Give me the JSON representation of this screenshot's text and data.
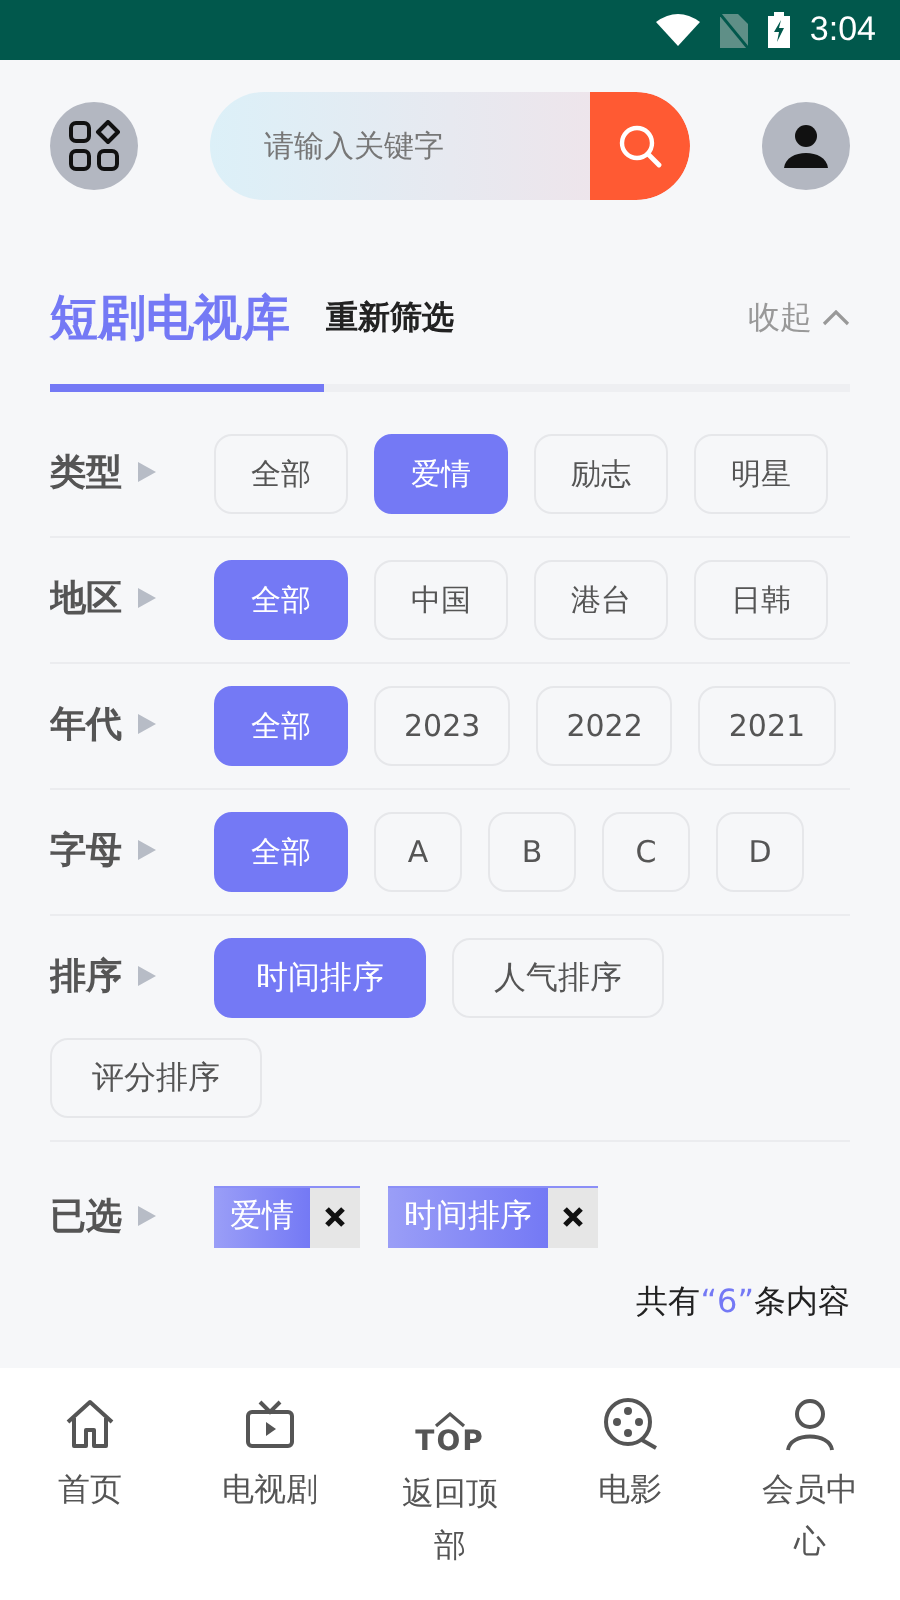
{
  "status_bar": {
    "time": "3:04"
  },
  "search": {
    "placeholder": "请输入关键字"
  },
  "header": {
    "title": "短剧电视库",
    "reset": "重新筛选",
    "collapse": "收起"
  },
  "filters": [
    {
      "label": "类型",
      "kind": "scroll",
      "options": [
        {
          "text": "全部",
          "selected": false
        },
        {
          "text": "爱情",
          "selected": true
        },
        {
          "text": "励志",
          "selected": false
        },
        {
          "text": "明星",
          "selected": false
        }
      ]
    },
    {
      "label": "地区",
      "kind": "scroll",
      "options": [
        {
          "text": "全部",
          "selected": true
        },
        {
          "text": "中国",
          "selected": false
        },
        {
          "text": "港台",
          "selected": false
        },
        {
          "text": "日韩",
          "selected": false
        }
      ]
    },
    {
      "label": "年代",
      "kind": "scroll",
      "options": [
        {
          "text": "全部",
          "selected": true
        },
        {
          "text": "2023",
          "selected": false
        },
        {
          "text": "2022",
          "selected": false
        },
        {
          "text": "2021",
          "selected": false
        }
      ]
    },
    {
      "label": "字母",
      "kind": "scroll",
      "options": [
        {
          "text": "全部",
          "selected": true
        },
        {
          "text": "A",
          "selected": false
        },
        {
          "text": "B",
          "selected": false
        },
        {
          "text": "C",
          "selected": false
        },
        {
          "text": "D",
          "selected": false
        }
      ]
    },
    {
      "label": "排序",
      "kind": "wrap",
      "options": [
        {
          "text": "时间排序",
          "selected": true
        },
        {
          "text": "人气排序",
          "selected": false
        },
        {
          "text": "评分排序",
          "selected": false
        }
      ]
    }
  ],
  "selected_filters": {
    "label": "已选",
    "tags": [
      "爱情",
      "时间排序"
    ]
  },
  "result_count": {
    "prefix": "共有",
    "count": "“6”",
    "suffix": "条内容"
  },
  "bottom_nav": [
    {
      "kind": "home",
      "label": "首页"
    },
    {
      "kind": "tv",
      "label": "电视剧"
    },
    {
      "kind": "top",
      "icon_text": "TOP",
      "label": "返回顶部"
    },
    {
      "kind": "film",
      "label": "电影"
    },
    {
      "kind": "user",
      "label": "会员中心"
    }
  ]
}
